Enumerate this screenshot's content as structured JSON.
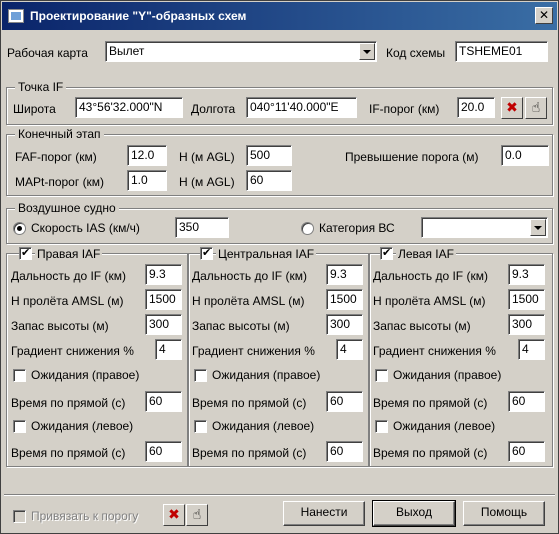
{
  "window": {
    "title": "Проектирование \"Y\"-образных схем",
    "close": "✕"
  },
  "top": {
    "map_label": "Рабочая карта",
    "map_value": "Вылет",
    "code_label": "Код схемы",
    "code_value": "TSHEME01"
  },
  "if_point": {
    "legend": "Точка IF",
    "lat_label": "Широта",
    "lat_value": "43°56'32.000\"N",
    "lon_label": "Долгота",
    "lon_value": "040°11'40.000\"E",
    "threshold_label": "IF-порог (км)",
    "threshold_value": "20.0"
  },
  "final": {
    "legend": "Конечный этап",
    "faf_label": "FAF-порог (км)",
    "faf_value": "12.0",
    "faf_h_label": "H (м AGL)",
    "faf_h_value": "500",
    "excess_label": "Превышение порога (м)",
    "excess_value": "0.0",
    "mapt_label": "MAPt-порог (км)",
    "mapt_value": "1.0",
    "mapt_h_label": "H (м AGL)",
    "mapt_h_value": "60"
  },
  "aircraft": {
    "legend": "Воздушное судно",
    "speed_label": "Скорость IAS (км/ч)",
    "speed_value": "350",
    "category_label": "Категория ВС",
    "category_value": ""
  },
  "iaf": [
    {
      "title": "Правая IAF",
      "dist_label": "Дальность до IF (км)",
      "dist": "9.3",
      "h_label": "Н пролёта AMSL (м)",
      "h": "1500",
      "reserve_label": "Запас высоты (м)",
      "reserve": "300",
      "grad_label": "Градиент снижения %",
      "grad": "4",
      "hold_right": "Ожидания (правое)",
      "time1_label": "Время по прямой (с)",
      "time1": "60",
      "hold_left": "Ожидания (левое)",
      "time2_label": "Время по прямой (с)",
      "time2": "60"
    },
    {
      "title": "Центральная IAF",
      "dist_label": "Дальность до IF (км)",
      "dist": "9.3",
      "h_label": "Н пролёта AMSL (м)",
      "h": "1500",
      "reserve_label": "Запас высоты (м)",
      "reserve": "300",
      "grad_label": "Градиент снижения %",
      "grad": "4",
      "hold_right": "Ожидания (правое)",
      "time1_label": "Время по прямой (с)",
      "time1": "60",
      "hold_left": "Ожидания (левое)",
      "time2_label": "Время по прямой (с)",
      "time2": "60"
    },
    {
      "title": "Левая IAF",
      "dist_label": "Дальность до IF (км)",
      "dist": "9.3",
      "h_label": "Н пролёта AMSL (м)",
      "h": "1500",
      "reserve_label": "Запас высоты (м)",
      "reserve": "300",
      "grad_label": "Градиент снижения %",
      "grad": "4",
      "hold_right": "Ожидания (правое)",
      "time1_label": "Время по прямой (с)",
      "time1": "60",
      "hold_left": "Ожидания (левое)",
      "time2_label": "Время по прямой (с)",
      "time2": "60"
    }
  ],
  "bottom": {
    "bind_label": "Привязать к порогу",
    "apply": "Нанести",
    "exit": "Выход",
    "help": "Помощь"
  },
  "icons": {
    "delete": "✖",
    "hand": "☝"
  }
}
